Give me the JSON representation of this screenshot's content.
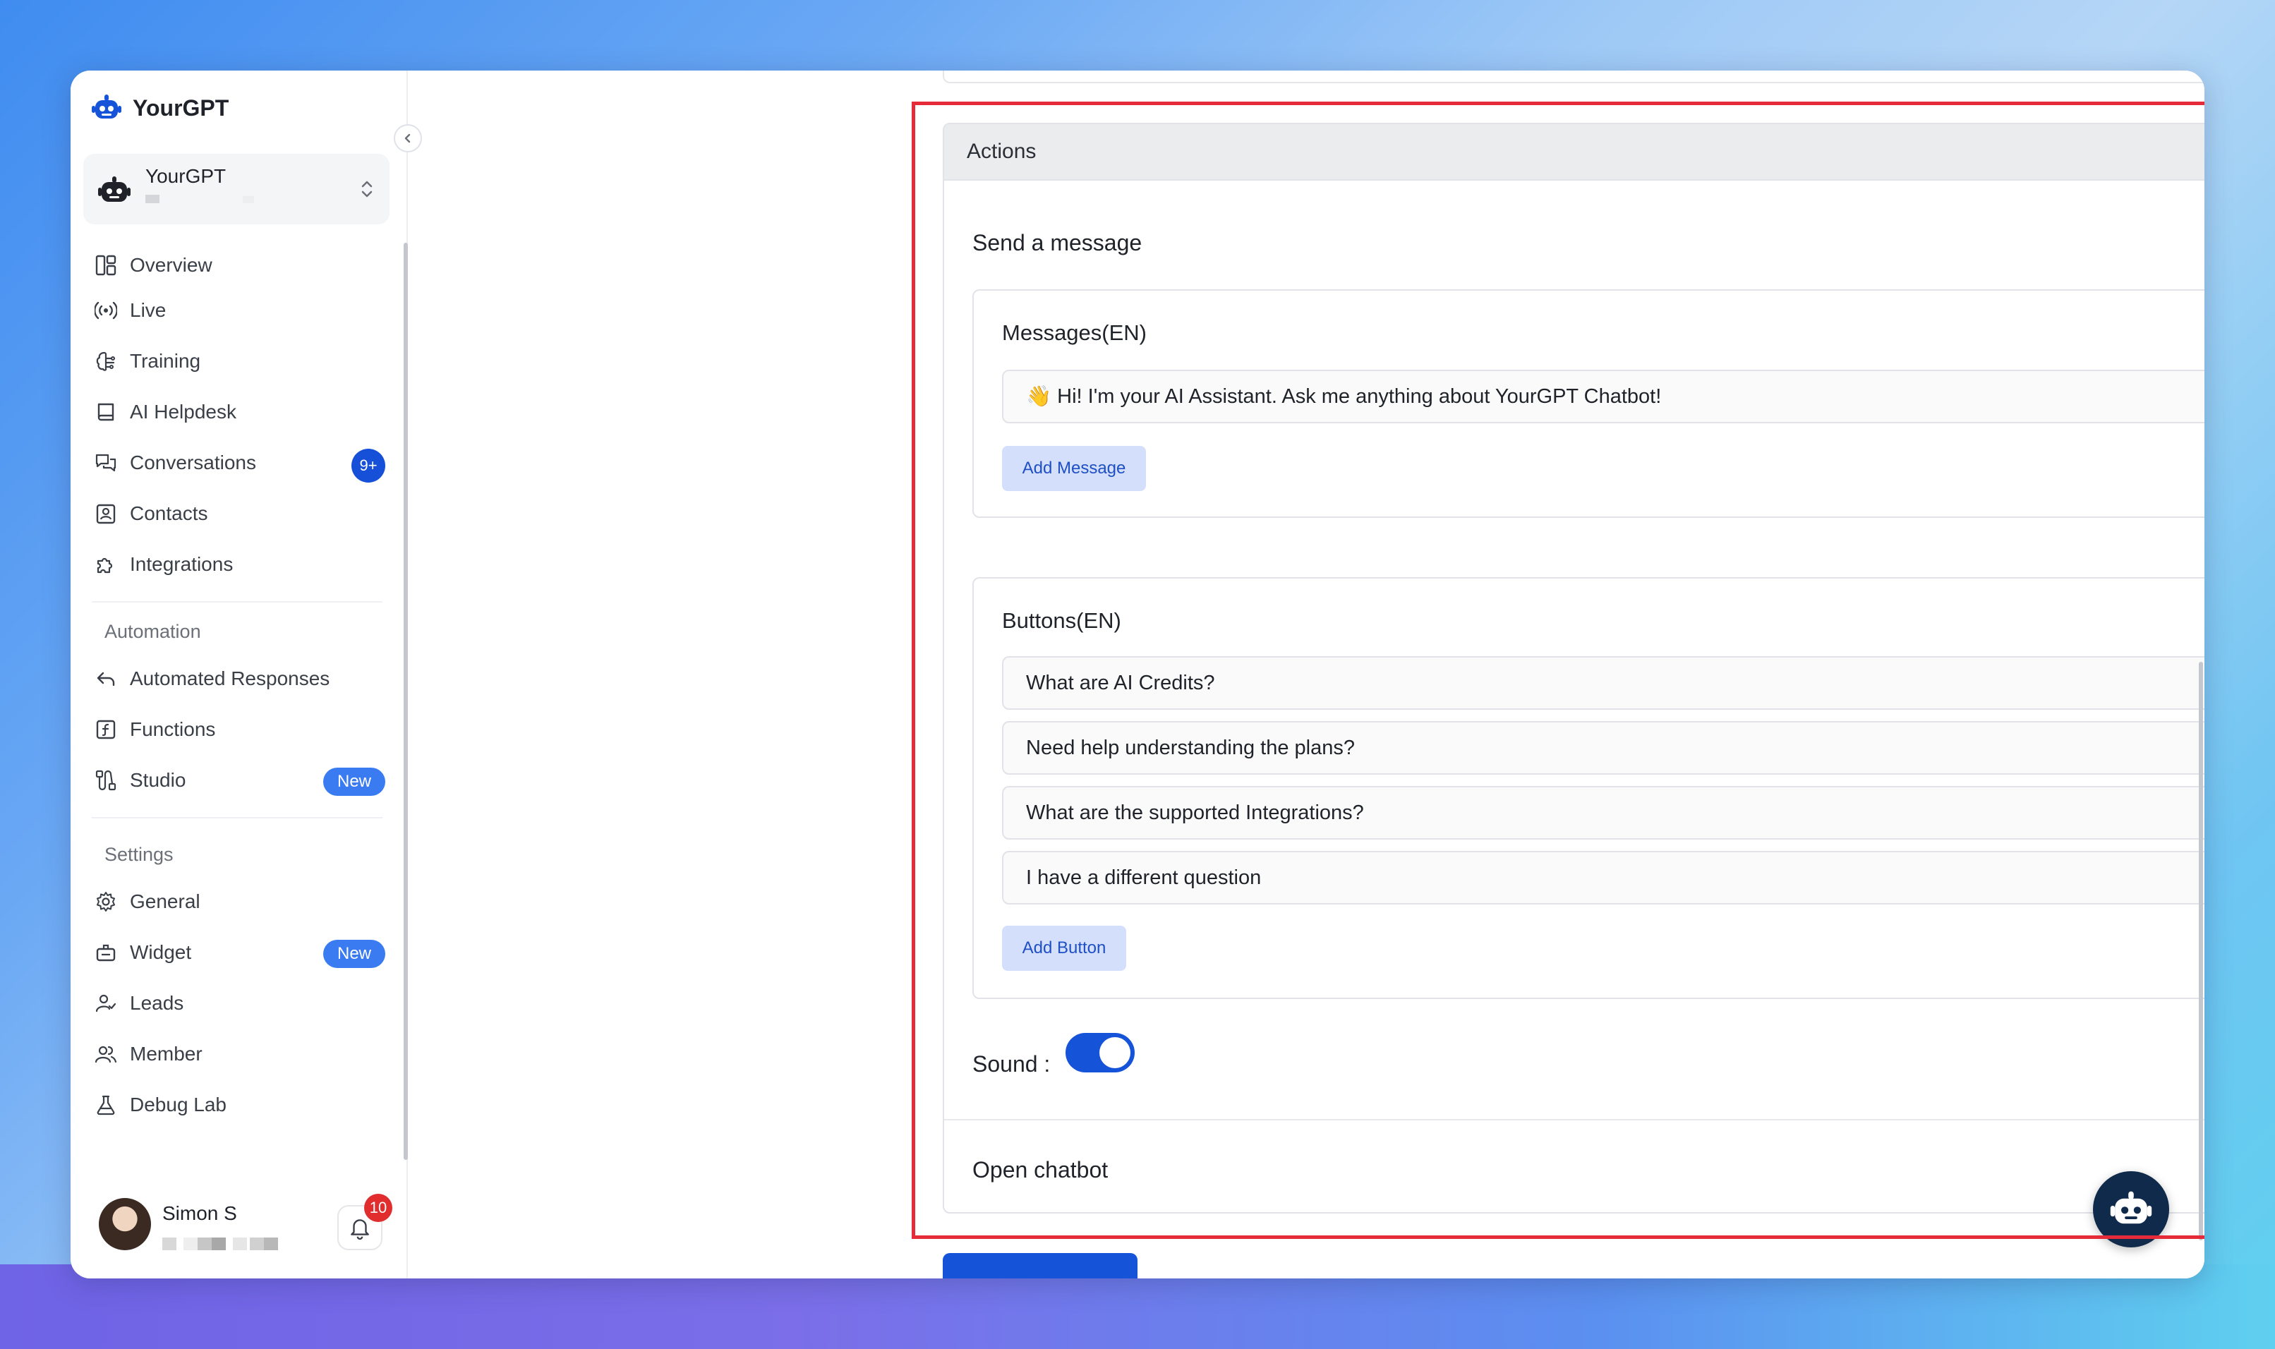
{
  "app": {
    "brand": "YourGPT"
  },
  "workspace": {
    "name": "YourGPT"
  },
  "nav": [
    {
      "label": "Overview",
      "icon": "layout-icon"
    },
    {
      "label": "Live",
      "icon": "broadcast-icon"
    },
    {
      "label": "Training",
      "icon": "brain-icon"
    },
    {
      "label": "AI Helpdesk",
      "icon": "book-icon"
    },
    {
      "label": "Conversations",
      "icon": "chat-icon",
      "badge": "9+"
    },
    {
      "label": "Contacts",
      "icon": "contact-icon"
    },
    {
      "label": "Integrations",
      "icon": "puzzle-icon"
    }
  ],
  "automation": {
    "heading": "Automation",
    "items": [
      {
        "label": "Automated Responses",
        "icon": "reply-icon"
      },
      {
        "label": "Functions",
        "icon": "function-icon"
      },
      {
        "label": "Studio",
        "icon": "flow-icon",
        "badge": "New"
      }
    ]
  },
  "settings": {
    "heading": "Settings",
    "items": [
      {
        "label": "General",
        "icon": "gear-icon"
      },
      {
        "label": "Widget",
        "icon": "widget-icon",
        "badge": "New"
      },
      {
        "label": "Leads",
        "icon": "user-check-icon"
      },
      {
        "label": "Member",
        "icon": "users-icon"
      },
      {
        "label": "Debug Lab",
        "icon": "flask-icon"
      }
    ]
  },
  "user": {
    "name": "Simon S",
    "notifications": "10"
  },
  "actions": {
    "title": "Actions",
    "send_message": {
      "label": "Send a message",
      "enabled": true
    },
    "messages": {
      "heading": "Messages(EN)",
      "items": [
        "👋 Hi! I'm your AI Assistant. Ask me anything about YourGPT Chatbot!"
      ],
      "add_label": "Add Message"
    },
    "buttons": {
      "heading": "Buttons(EN)",
      "items": [
        "What are AI Credits?",
        "Need help understanding the plans?",
        "What are the supported Integrations?",
        "I have a different question"
      ],
      "add_label": "Add Button"
    },
    "sound": {
      "label": "Sound :",
      "enabled": true
    },
    "open_chatbot": {
      "label": "Open chatbot",
      "enabled": false
    }
  },
  "colors": {
    "primary": "#1553d9",
    "highlight": "#e52a3a"
  }
}
